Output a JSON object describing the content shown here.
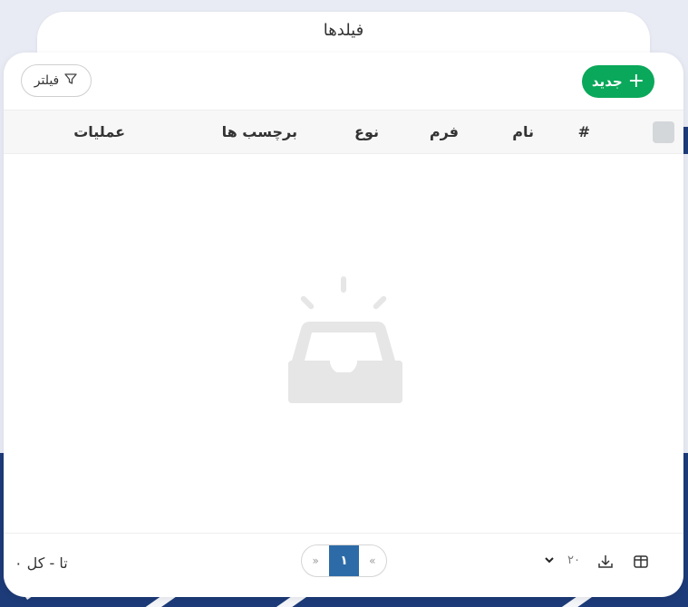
{
  "page": {
    "title": "فیلدها"
  },
  "toolbar": {
    "new_label": "جدید",
    "new_icon": "plus-icon",
    "filter_label": "فیلتر",
    "filter_icon": "filter-icon"
  },
  "table": {
    "columns": [
      "#",
      "نام",
      "فرم",
      "نوع",
      "برچسب ها",
      "عملیات"
    ],
    "rows": []
  },
  "empty_state": {
    "icon": "empty-inbox-icon"
  },
  "footer": {
    "total_text": "تا - کل ۰",
    "current_page": "۱",
    "prev_label": "«",
    "next_label": "»",
    "page_size": "۲۰",
    "download_icon": "download-icon",
    "columns_icon": "columns-icon"
  },
  "colors": {
    "primary": "#0aa85a",
    "page_active": "#2d6ba8",
    "header_bg": "#f7f7f8",
    "background_deco": "#1d3b78"
  }
}
